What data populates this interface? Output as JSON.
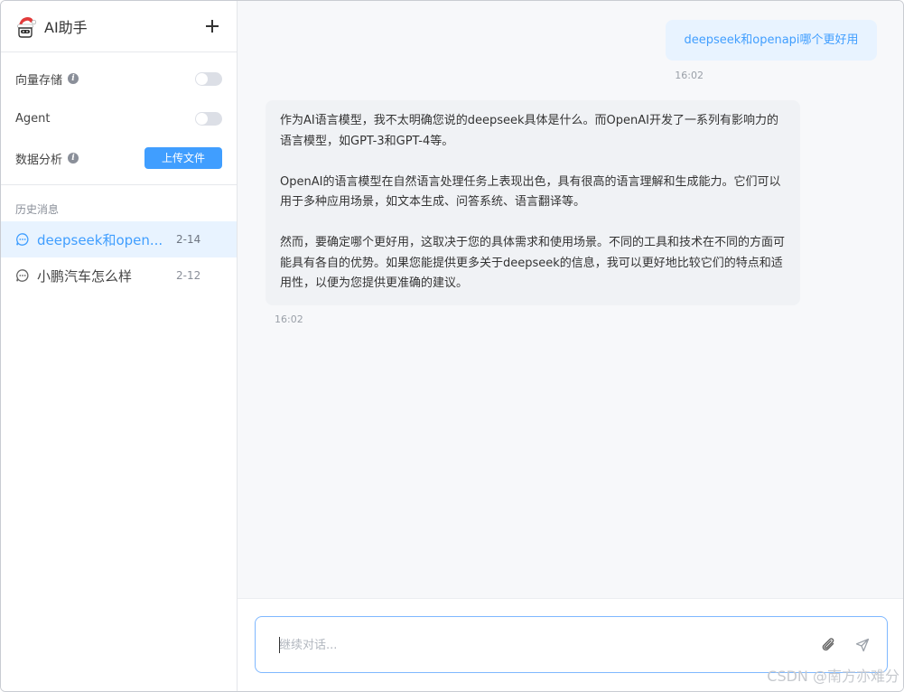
{
  "app": {
    "title": "AI助手"
  },
  "settings": [
    {
      "label": "向量存储",
      "has_info": true,
      "control": "toggle",
      "on": false
    },
    {
      "label": "Agent",
      "has_info": false,
      "control": "toggle",
      "on": false
    },
    {
      "label": "数据分析",
      "has_info": true,
      "control": "button",
      "button_label": "上传文件"
    }
  ],
  "history": {
    "title": "历史消息",
    "items": [
      {
        "title": "deepseek和open...",
        "date": "2-14",
        "active": true
      },
      {
        "title": "小鹏汽车怎么样",
        "date": "2-12",
        "active": false
      }
    ]
  },
  "chat": {
    "user_message": {
      "text": "deepseek和openapi哪个更好用",
      "time": "16:02"
    },
    "ai_message": {
      "paragraphs": [
        "作为AI语言模型，我不太明确您说的deepseek具体是什么。而OpenAI开发了一系列有影响力的语言模型，如GPT-3和GPT-4等。",
        "OpenAI的语言模型在自然语言处理任务上表现出色，具有很高的语言理解和生成能力。它们可以用于多种应用场景，如文本生成、问答系统、语言翻译等。",
        "然而，要确定哪个更好用，这取决于您的具体需求和使用场景。不同的工具和技术在不同的方面可能具有各自的优势。如果您能提供更多关于deepseek的信息，我可以更好地比较它们的特点和适用性，以便为您提供更准确的建议。"
      ],
      "time": "16:02"
    }
  },
  "input": {
    "placeholder": "继续对话...",
    "value": ""
  },
  "icons": {
    "logo": "santa-hat-logo-icon",
    "add": "plus-icon",
    "info": "info-icon",
    "history_item": "chat-bubble-icon",
    "attach": "paperclip-icon",
    "send": "send-icon"
  },
  "colors": {
    "accent": "#409eff",
    "active_bg": "#e8f3ff",
    "main_bg": "#f7f8fa",
    "bubble_bg": "#f0f2f5"
  },
  "watermark": "CSDN @南方亦难分"
}
